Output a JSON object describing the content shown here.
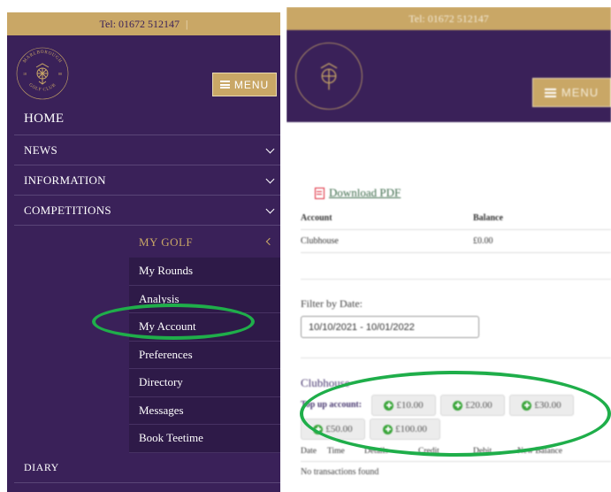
{
  "left": {
    "topbar": {
      "phone": "Tel: 01672 512147",
      "separator": "|"
    },
    "logo": {
      "top_text": "MARLBOROUGH",
      "bottom_text": "GOLF CLUB",
      "num_left": "18",
      "num_right": "88"
    },
    "menu_button": {
      "label": "MENU"
    },
    "nav": [
      {
        "label": "HOME"
      },
      {
        "label": "NEWS"
      },
      {
        "label": "INFORMATION"
      },
      {
        "label": "COMPETITIONS"
      }
    ],
    "my_golf": {
      "label": "MY GOLF"
    },
    "submenu": [
      {
        "label": "My Rounds"
      },
      {
        "label": "Analysis"
      },
      {
        "label": "My Account"
      },
      {
        "label": "Preferences"
      },
      {
        "label": "Directory"
      },
      {
        "label": "Messages"
      },
      {
        "label": "Book Teetime"
      }
    ],
    "diary": {
      "label": "DIARY"
    },
    "highlight_color": "#1fae4a"
  },
  "right": {
    "topbar": {
      "phone": "Tel: 01672 512147"
    },
    "menu_button": {
      "label": "MENU"
    },
    "download_pdf": "Download PDF",
    "account_table": {
      "headers": [
        "Account",
        "Balance"
      ],
      "rows": [
        [
          "Clubhouse",
          "£0.00"
        ]
      ]
    },
    "filter_label": "Filter by Date:",
    "date_range": "10/10/2021 - 10/01/2022",
    "clubhouse_title": "Clubhouse",
    "topup_label": "Top up account:",
    "amounts": [
      "£10.00",
      "£20.00",
      "£30.00",
      "£50.00",
      "£100.00"
    ],
    "transaction_headers": [
      "Date",
      "Time",
      "Details",
      "Credit",
      "Debit",
      "New Balance"
    ],
    "no_transactions": "No transactions found"
  },
  "colors": {
    "brand_purple": "#3a2159",
    "gold": "#c9a766",
    "highlight": "#1fae4a"
  }
}
